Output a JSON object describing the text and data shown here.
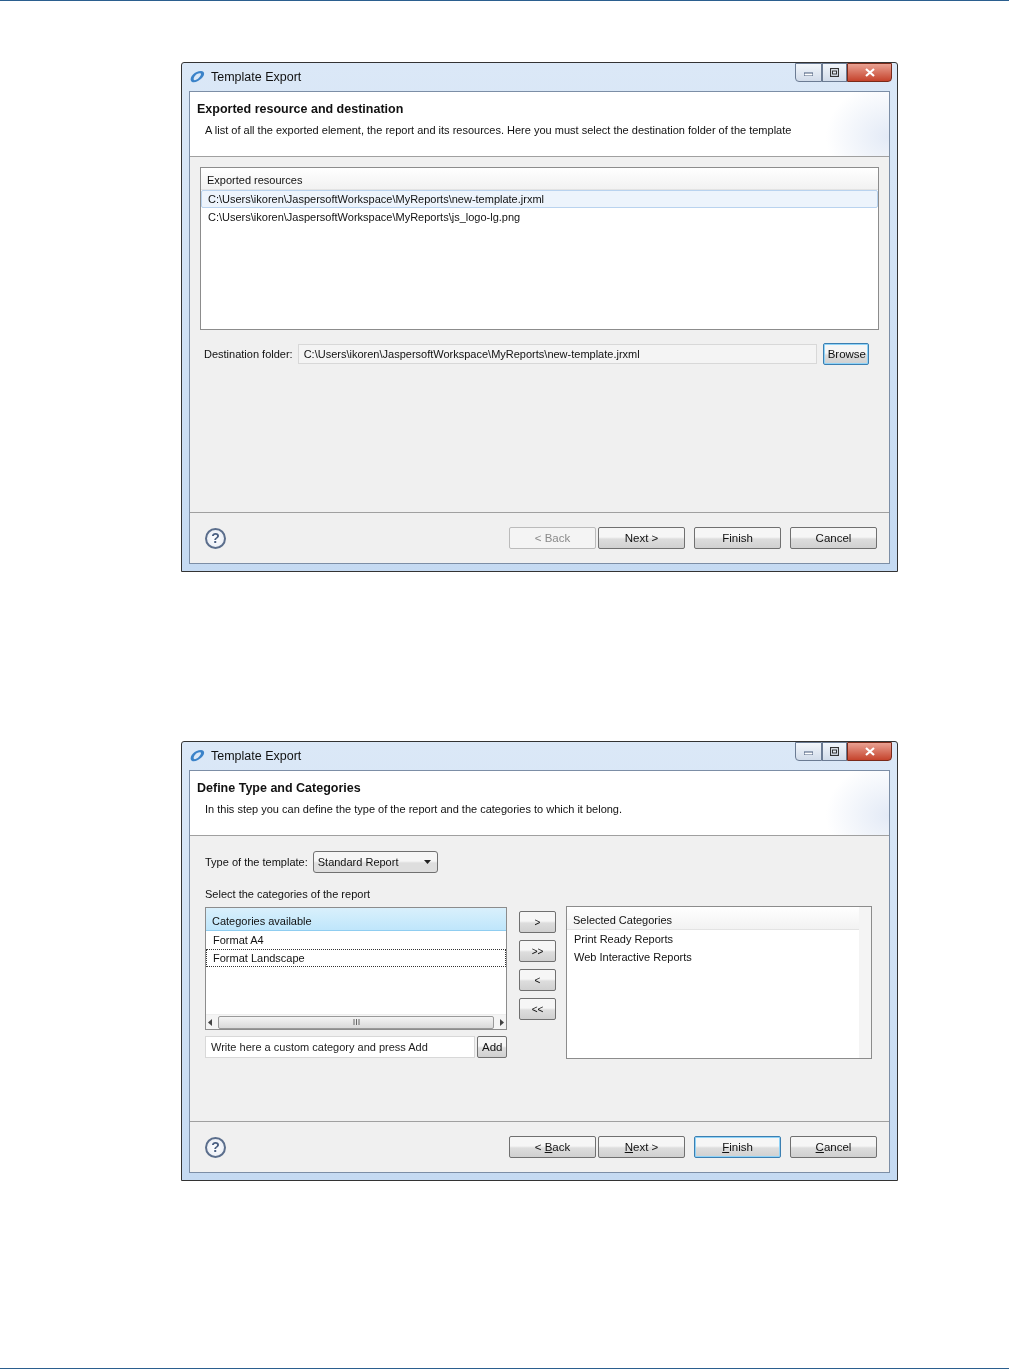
{
  "dialogs": [
    {
      "kind": "resources",
      "title": "Template Export",
      "heading": "Exported resource and destination",
      "description": "A list of all the exported element, the report and its resources. Here you must select the destination folder of the template",
      "mnemonics": false,
      "resources": {
        "header": "Exported resources",
        "items": [
          {
            "text": "C:\\Users\\ikoren\\JaspersoftWorkspace\\MyReports\\new-template.jrxml",
            "selected": true
          },
          {
            "text": "C:\\Users\\ikoren\\JaspersoftWorkspace\\MyReports\\js_logo-lg.png",
            "selected": false
          }
        ]
      },
      "destination": {
        "label": "Destination folder:",
        "value": "C:\\Users\\ikoren\\JaspersoftWorkspace\\MyReports\\new-template.jrxml",
        "button": "Browse"
      },
      "help": "?",
      "buttons": [
        {
          "label": "< Back",
          "disabled": true,
          "default": false
        },
        {
          "label": "Next >",
          "disabled": false,
          "default": false
        },
        {
          "label": "Finish",
          "disabled": false,
          "default": false
        },
        {
          "label": "Cancel",
          "disabled": false,
          "default": false
        }
      ]
    },
    {
      "kind": "categories",
      "title": "Template Export",
      "heading": "Define Type and Categories",
      "description": "In this step you can define the type of the report and the categories to which it belong.",
      "mnemonics": true,
      "type_field": {
        "label": "Type of the template:",
        "value": "Standard Report"
      },
      "categories_label": "Select the categories of the report",
      "available": {
        "header": "Categories available",
        "items": [
          {
            "text": "Format A4",
            "focused": false
          },
          {
            "text": "Format Landscape",
            "focused": true
          }
        ]
      },
      "move_buttons": [
        ">",
        ">>",
        "<",
        "<<"
      ],
      "custom": {
        "value": "Write here a custom category and press Add",
        "button": "Add"
      },
      "chosen": {
        "header": "Selected Categories",
        "items": [
          "Print Ready Reports",
          "Web Interactive Reports"
        ]
      },
      "help": "?",
      "buttons": [
        {
          "label": "< Back",
          "disabled": false,
          "default": false
        },
        {
          "label": "Next >",
          "disabled": false,
          "default": false
        },
        {
          "label": "Finish",
          "disabled": false,
          "default": true
        },
        {
          "label": "Cancel",
          "disabled": false,
          "default": false
        }
      ]
    }
  ]
}
